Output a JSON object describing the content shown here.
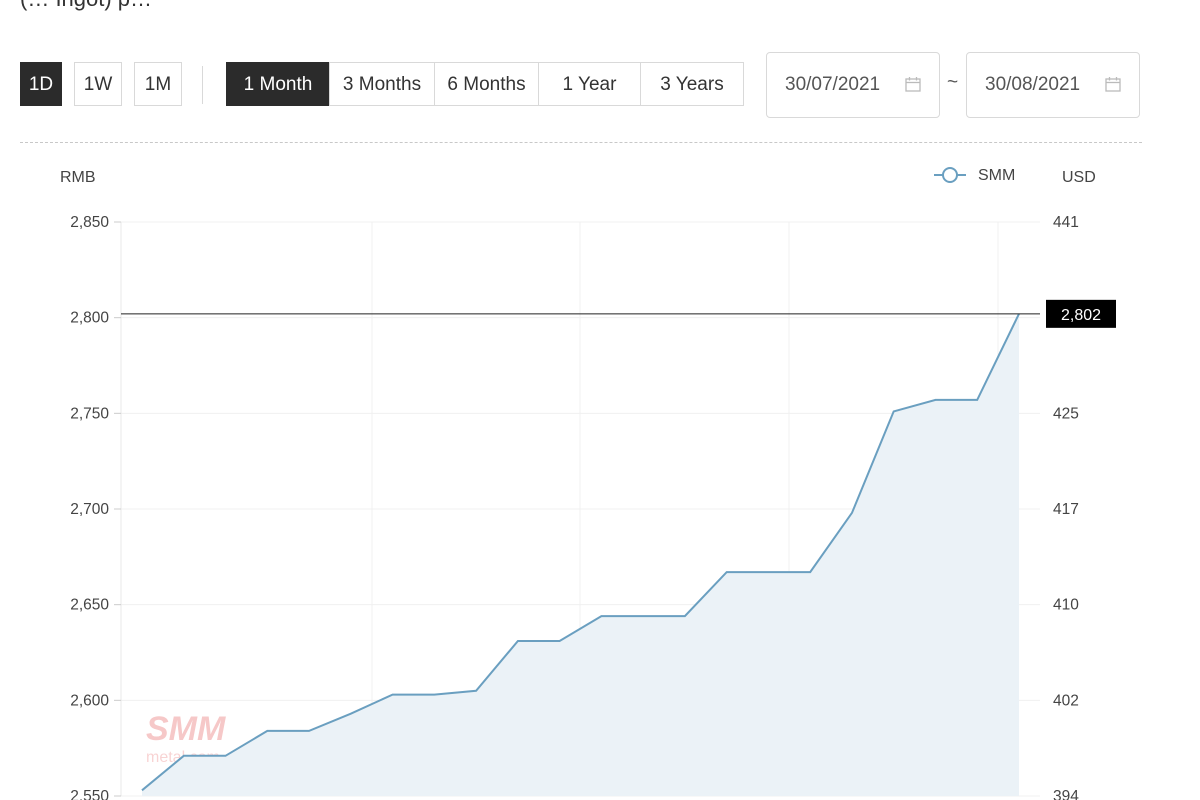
{
  "page": {
    "title_fragment": "(… Ingot) p…"
  },
  "toolbar": {
    "interval_buttons": [
      {
        "label": "1D",
        "active": true
      },
      {
        "label": "1W",
        "active": false
      },
      {
        "label": "1M",
        "active": false
      }
    ],
    "range_buttons": [
      {
        "label": "1 Month",
        "active": true
      },
      {
        "label": "3 Months",
        "active": false
      },
      {
        "label": "6 Months",
        "active": false
      },
      {
        "label": "1 Year",
        "active": false
      },
      {
        "label": "3 Years",
        "active": false
      }
    ],
    "start_date": "30/07/2021",
    "separator": "~",
    "end_date": "30/08/2021",
    "calendar_icon": "calendar-icon"
  },
  "chart_data": {
    "type": "area",
    "left_axis_label": "RMB",
    "right_axis_label": "USD",
    "left_ticks": [
      "2,850",
      "2,800",
      "2,750",
      "2,700",
      "2,650",
      "2,600",
      "2,550"
    ],
    "right_ticks": [
      "441",
      "425",
      "417",
      "410",
      "402",
      "394"
    ],
    "ylim": [
      2550,
      2850
    ],
    "series": [
      {
        "name": "SMM",
        "values": [
          2553,
          2571,
          2571,
          2584,
          2584,
          2593,
          2603,
          2603,
          2605,
          2631,
          2631,
          2644,
          2644,
          2644,
          2667,
          2667,
          2667,
          2698,
          2751,
          2757,
          2757,
          2802
        ]
      }
    ],
    "last_value_label": "2,802",
    "last_value": 2802,
    "grid": true,
    "legend_position": "top-right",
    "colors": {
      "line": "#6a9fc0",
      "fill": "#ebf2f7",
      "tag_bg": "#000000"
    },
    "watermark": {
      "main": "SMM",
      "sub": "metal.com"
    }
  }
}
